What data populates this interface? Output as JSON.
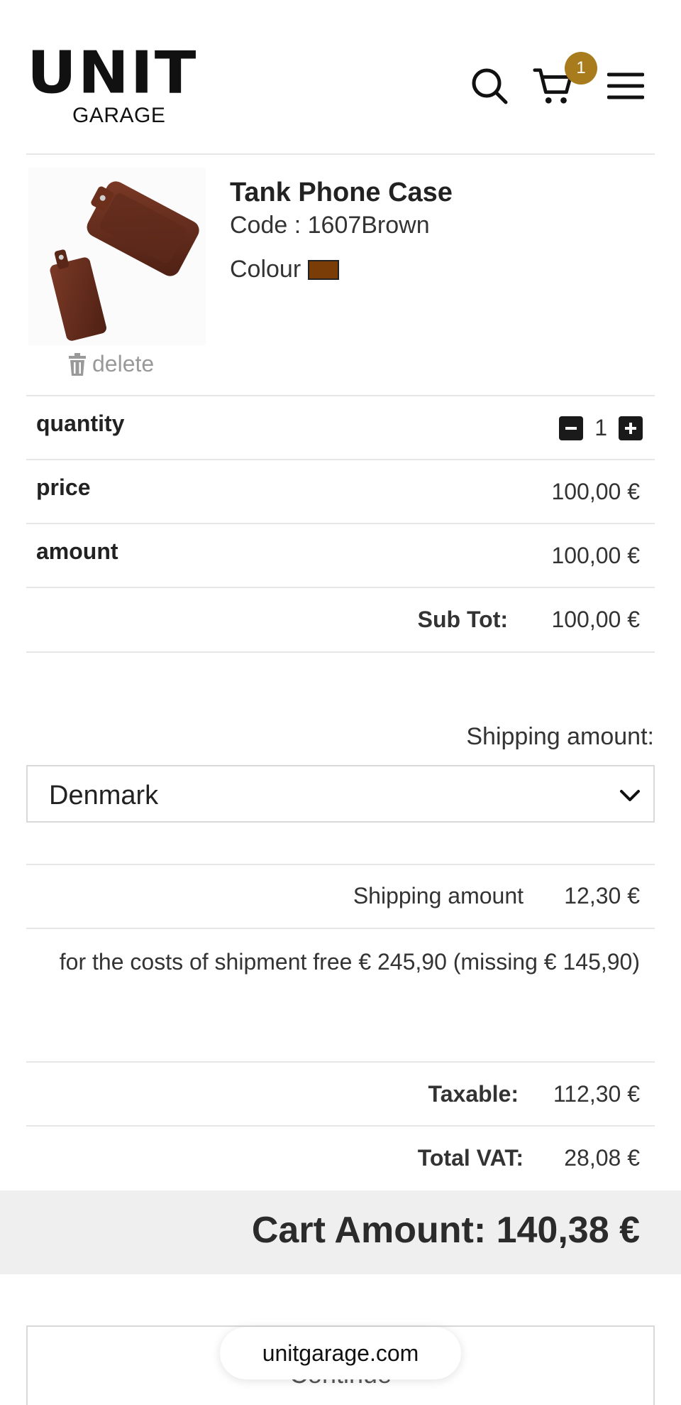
{
  "header": {
    "logo_main": "UNIT",
    "logo_sub": "GARAGE",
    "logo_reg": "®",
    "cart_count": "1",
    "icons": [
      "search-icon",
      "cart-icon",
      "hamburger-menu-icon"
    ]
  },
  "product": {
    "name": "Tank Phone Case",
    "code": "Code : 1607Brown",
    "colour_label": "Colour",
    "colour_hex": "#7a3d08",
    "delete_label": "delete"
  },
  "rows": {
    "quantity_label": "quantity",
    "quantity_value": "1",
    "price_label": "price",
    "price_value": "100,00 €",
    "amount_label": "amount",
    "amount_value": "100,00 €",
    "subtot_label": "Sub Tot:",
    "subtot_value": "100,00 €"
  },
  "shipping": {
    "heading": "Shipping amount:",
    "country": "Denmark",
    "amount_label": "Shipping amount",
    "amount_value": "12,30 €",
    "free_note": "for the costs of shipment free € 245,90 (missing € 145,90)"
  },
  "totals": {
    "taxable_label": "Taxable:",
    "taxable_value": "112,30 €",
    "vat_label": "Total VAT:",
    "vat_value": "28,08 €",
    "cart_amount": "Cart Amount: 140,38 €"
  },
  "footer": {
    "continue_label": "Continue",
    "url": "unitgarage.com"
  },
  "colors": {
    "accent": "#a87c1d",
    "total_bar": "#efefef"
  }
}
